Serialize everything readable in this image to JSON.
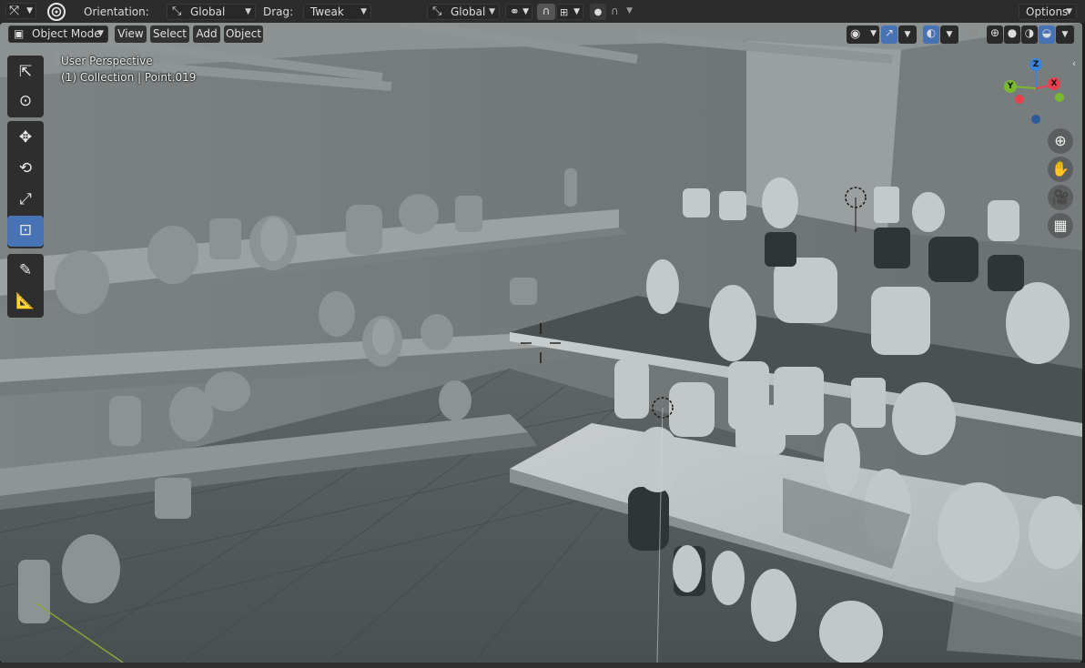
{
  "topbar": {
    "orientation_label": "Orientation:",
    "orientation_value": "Global",
    "drag_label": "Drag:",
    "drag_value": "Tweak",
    "transform_orientation_value": "Global",
    "options_label": "Options"
  },
  "header": {
    "mode": "Object Mode",
    "menus": [
      "View",
      "Select",
      "Add",
      "Object"
    ]
  },
  "viewport": {
    "view_name": "User Perspective",
    "collection_info": "(1) Collection | Point.019"
  },
  "gizmo": {
    "z": "Z",
    "y": "Y",
    "x": "X",
    "colors": {
      "x": "#e8404f",
      "y": "#7ab82f",
      "z": "#3b83d9"
    }
  },
  "tools": [
    {
      "name": "select-box-tool",
      "icon": "cursor-icon"
    },
    {
      "name": "cursor-tool",
      "icon": "3d-cursor-icon"
    },
    {
      "name": "move-tool",
      "icon": "move-icon"
    },
    {
      "name": "rotate-tool",
      "icon": "rotate-icon"
    },
    {
      "name": "scale-tool",
      "icon": "scale-icon"
    },
    {
      "name": "transform-tool",
      "icon": "transform-icon",
      "active": true
    },
    {
      "name": "annotate-tool",
      "icon": "annotate-icon"
    },
    {
      "name": "measure-tool",
      "icon": "measure-icon"
    }
  ],
  "colors": {
    "accent": "#4772b3",
    "viewport_bg": "#6f7575",
    "header_bg": "#2c2c2c"
  }
}
